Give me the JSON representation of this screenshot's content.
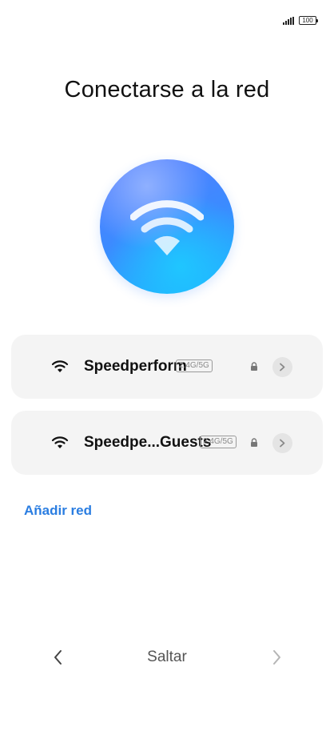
{
  "status_bar": {
    "battery_level": "100",
    "signal_icon": "cellular-signal-icon"
  },
  "title": "Conectarse a la red",
  "networks": [
    {
      "name": "Speedperform",
      "band": "2.4G/5G",
      "secured": true
    },
    {
      "name": "Speedpe...Guests",
      "band": "2.4G/5G",
      "secured": true
    }
  ],
  "add_network_label": "Añadir red",
  "nav": {
    "skip_label": "Saltar"
  },
  "colors": {
    "accent": "#2a7de1",
    "card_bg": "#f4f4f4",
    "hero_start": "#5a7dff",
    "hero_end": "#1ab8ff"
  }
}
